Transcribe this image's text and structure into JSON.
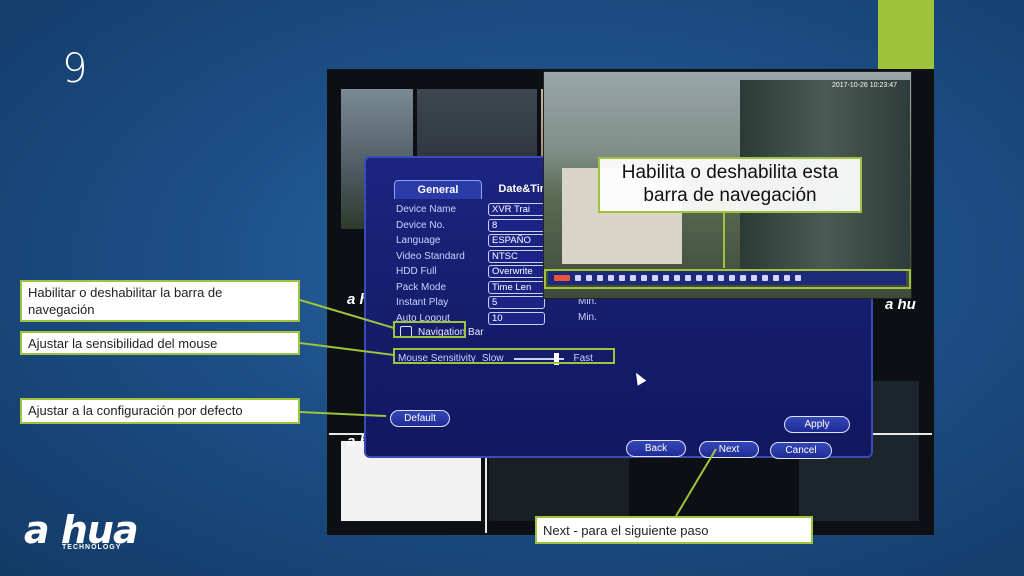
{
  "slide_number": "9",
  "colors": {
    "accent": "#9fc33a",
    "background": "#1c4f86",
    "dialog": "#141c6a"
  },
  "dvr_dialog": {
    "tabs": [
      "General",
      "Date&Tim"
    ],
    "settings": [
      {
        "label": "Device Name",
        "value": "XVR Trai"
      },
      {
        "label": "Device No.",
        "value": "8"
      },
      {
        "label": "Language",
        "value": "ESPAÑO"
      },
      {
        "label": "Video Standard",
        "value": "NTSC"
      },
      {
        "label": "HDD Full",
        "value": "Overwrite"
      },
      {
        "label": "Pack Mode",
        "value": "Time Len"
      },
      {
        "label": "Instant Play",
        "value": "5"
      },
      {
        "label": "Auto Logout",
        "value": "10"
      }
    ],
    "units": {
      "instant_play": "Min.",
      "auto_logout": "Min."
    },
    "navigation_bar_label": "Navigation Bar",
    "mouse_sensitivity": {
      "label": "Mouse Sensitivity",
      "slow": "Slow",
      "fast": "Fast"
    },
    "buttons": {
      "default": "Default",
      "apply": "Apply",
      "back": "Back",
      "next": "Next",
      "cancel": "Cancel"
    }
  },
  "inset": {
    "timestamp": "2017-10-26 10:23:47"
  },
  "callouts": {
    "navbar_inset": "Habilita o deshabilita esta barra de navegación",
    "navbar_checkbox": "Habilitar o deshabilitar la barra de navegación",
    "mouse": "Ajustar la sensibilidad del mouse",
    "default": "Ajustar a la configuración por defecto",
    "next": "Next - para el siguiente paso"
  },
  "brand": {
    "name": "a hua",
    "tagline": "TECHNOLOGY",
    "small_mark": "a hu"
  }
}
